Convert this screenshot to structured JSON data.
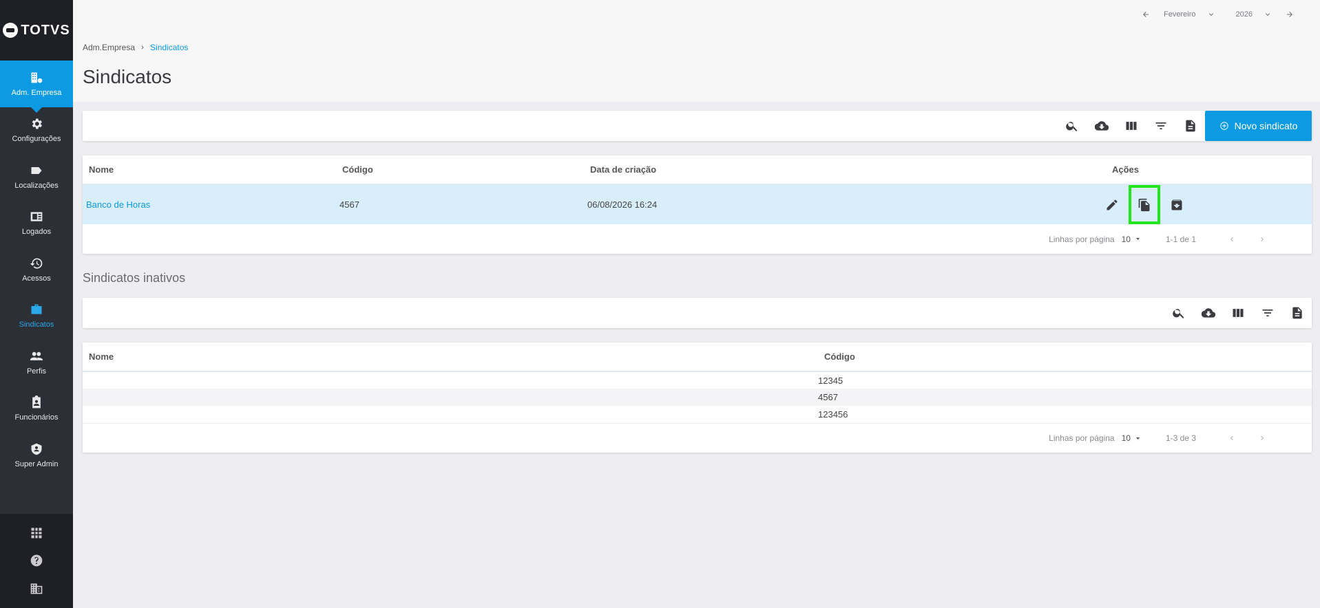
{
  "brand": {
    "name": "TOTVS"
  },
  "sidebar": {
    "items": [
      {
        "label": "Adm. Empresa",
        "icon": "company-settings-icon"
      },
      {
        "label": "Configurações",
        "icon": "gear-icon"
      },
      {
        "label": "Localizações",
        "icon": "label-tag-icon"
      },
      {
        "label": "Logados",
        "icon": "id-badge-icon"
      },
      {
        "label": "Acessos",
        "icon": "history-icon"
      },
      {
        "label": "Sindicatos",
        "icon": "briefcase-icon"
      },
      {
        "label": "Perfis",
        "icon": "people-icon"
      },
      {
        "label": "Funcionários",
        "icon": "clipboard-person-icon"
      },
      {
        "label": "Super Admin",
        "icon": "shield-user-icon"
      }
    ],
    "bottom_icons": [
      "apps-grid-icon",
      "help-icon",
      "building-icon"
    ]
  },
  "date_nav": {
    "month": "Fevereiro",
    "year": "2026"
  },
  "breadcrumb": {
    "parent": "Adm.Empresa",
    "current": "Sindicatos"
  },
  "page": {
    "title": "Sindicatos"
  },
  "toolbar": {
    "new_label": "Novo sindicato"
  },
  "active_table": {
    "headers": {
      "name": "Nome",
      "code": "Código",
      "created": "Data de criação",
      "actions": "Ações"
    },
    "rows": [
      {
        "name": "Banco de Horas",
        "code": "4567",
        "created": "06/08/2026 16:24"
      }
    ],
    "pager": {
      "rows_label": "Linhas por página",
      "rows_value": "10",
      "range": "1-1 de 1"
    }
  },
  "inactive_section": {
    "title": "Sindicatos inativos"
  },
  "inactive_table": {
    "headers": {
      "name": "Nome",
      "code": "Código"
    },
    "rows": [
      {
        "name": "",
        "code": "12345"
      },
      {
        "name": "",
        "code": "4567"
      },
      {
        "name": "",
        "code": "123456"
      }
    ],
    "pager": {
      "rows_label": "Linhas por página",
      "rows_value": "10",
      "range": "1-3 de 3"
    }
  },
  "colors": {
    "accent": "#0c9ae2",
    "highlight": "#22e51b",
    "sidebar": "#2d2f36"
  }
}
